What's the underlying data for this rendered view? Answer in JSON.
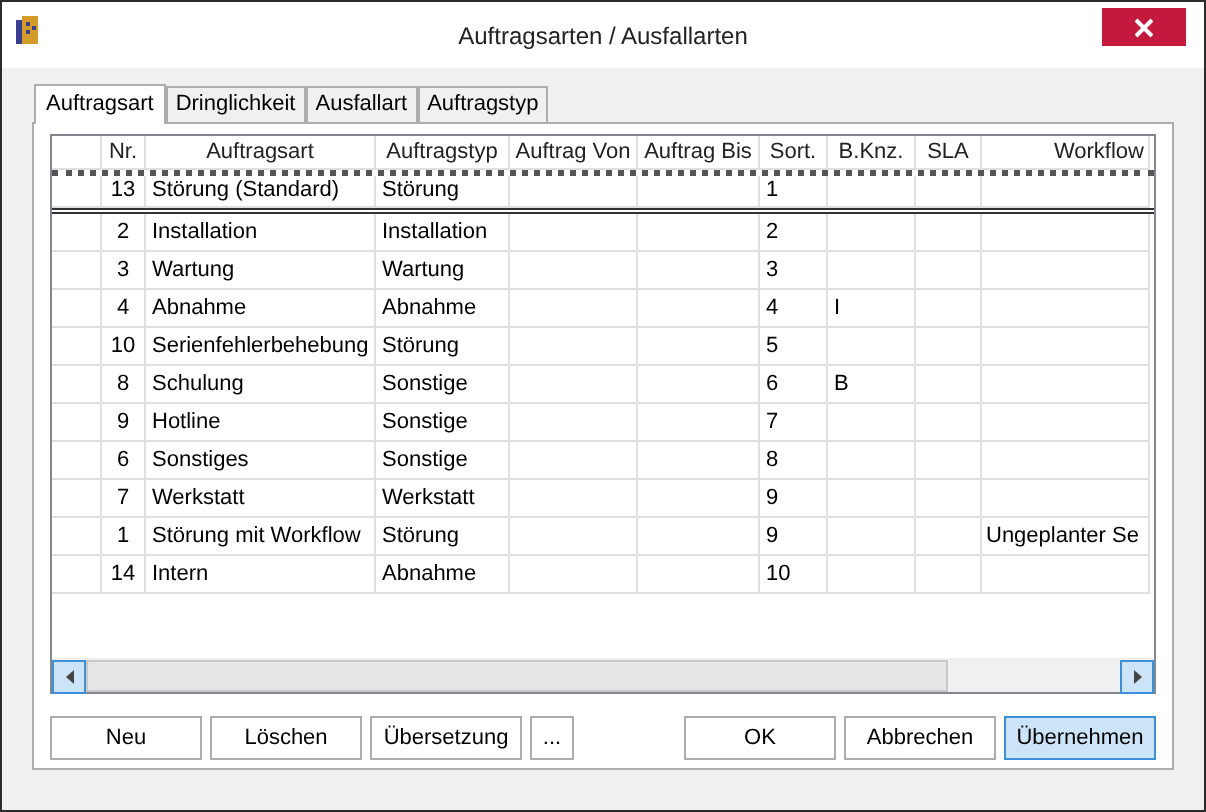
{
  "window": {
    "title": "Auftragsarten / Ausfallarten"
  },
  "tabs": [
    {
      "label": "Auftragsart",
      "selected": true
    },
    {
      "label": "Dringlichkeit",
      "selected": false
    },
    {
      "label": "Ausfallart",
      "selected": false
    },
    {
      "label": "Auftragstyp",
      "selected": false
    }
  ],
  "table": {
    "columns": [
      "Nr.",
      "Auftragsart",
      "Auftragstyp",
      "Auftrag Von",
      "Auftrag Bis",
      "Sort.",
      "B.Knz.",
      "SLA",
      "Workflow"
    ],
    "frozen_rows": [
      [
        "13",
        "Störung (Standard)",
        "Störung",
        "",
        "",
        "1",
        "",
        "",
        ""
      ]
    ],
    "rows": [
      [
        "2",
        "Installation",
        "Installation",
        "",
        "",
        "2",
        "",
        "",
        ""
      ],
      [
        "3",
        "Wartung",
        "Wartung",
        "",
        "",
        "3",
        "",
        "",
        ""
      ],
      [
        "4",
        "Abnahme",
        "Abnahme",
        "",
        "",
        "4",
        "I",
        "",
        ""
      ],
      [
        "10",
        "Serienfehlerbehebung",
        "Störung",
        "",
        "",
        "5",
        "",
        "",
        ""
      ],
      [
        "8",
        "Schulung",
        "Sonstige",
        "",
        "",
        "6",
        "B",
        "",
        ""
      ],
      [
        "9",
        "Hotline",
        "Sonstige",
        "",
        "",
        "7",
        "",
        "",
        ""
      ],
      [
        "6",
        "Sonstiges",
        "Sonstige",
        "",
        "",
        "8",
        "",
        "",
        ""
      ],
      [
        "7",
        "Werkstatt",
        "Werkstatt",
        "",
        "",
        "9",
        "",
        "",
        ""
      ],
      [
        "1",
        "Störung mit Workflow",
        "Störung",
        "",
        "",
        "9",
        "",
        "",
        "Ungeplanter Se"
      ],
      [
        "14",
        "Intern",
        "Abnahme",
        "",
        "",
        "10",
        "",
        "",
        ""
      ]
    ]
  },
  "buttons_left": [
    {
      "label": "Neu",
      "focused": false
    },
    {
      "label": "Löschen",
      "focused": false
    },
    {
      "label": "Übersetzung",
      "focused": false
    },
    {
      "label": "...",
      "focused": false
    }
  ],
  "buttons_right": [
    {
      "label": "OK",
      "focused": false
    },
    {
      "label": "Abbrechen",
      "focused": false
    },
    {
      "label": "Übernehmen",
      "focused": true
    }
  ]
}
